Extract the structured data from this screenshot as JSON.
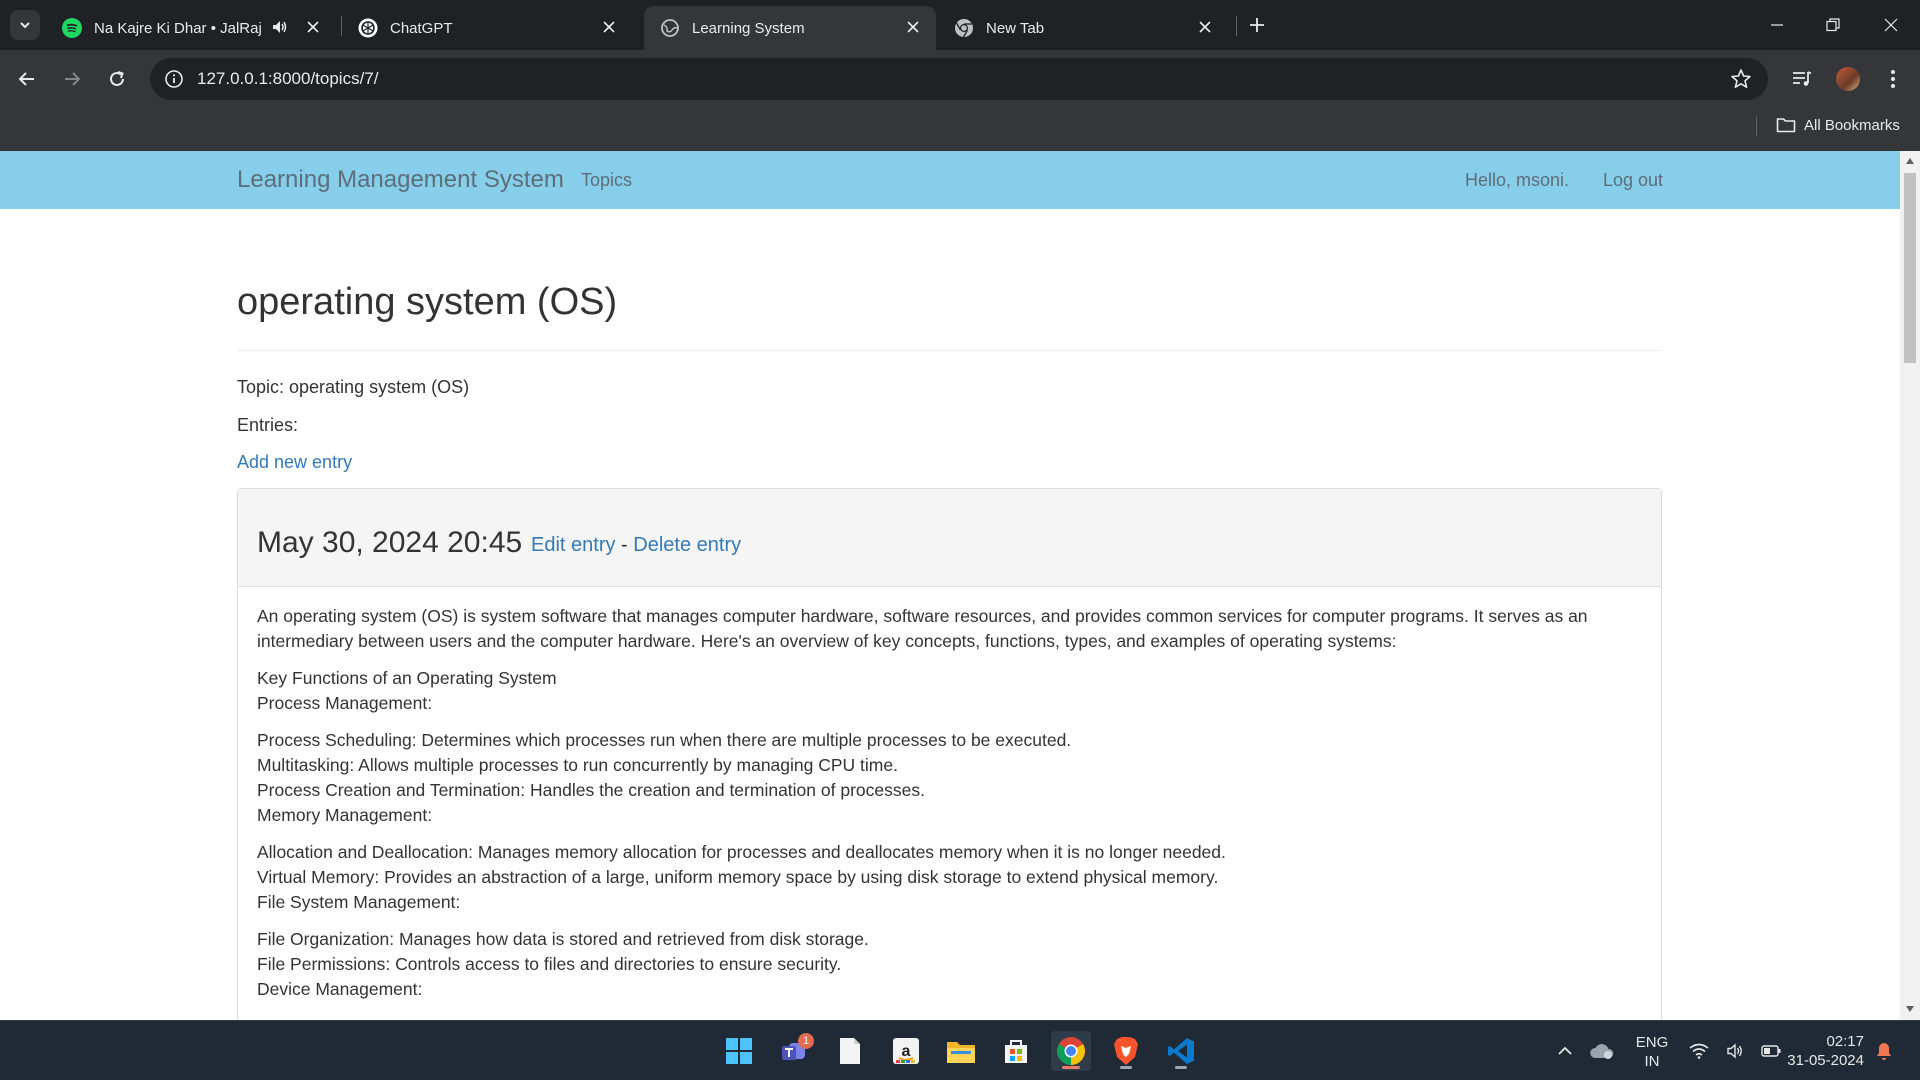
{
  "browser": {
    "tabs": [
      {
        "title": "Na Kajre Ki Dhar • JalRaj",
        "icon": "spotify-icon",
        "audio": true,
        "active": false
      },
      {
        "title": "ChatGPT",
        "icon": "chatgpt-icon",
        "active": false
      },
      {
        "title": "Learning System",
        "icon": "globe-icon",
        "active": true
      },
      {
        "title": "New Tab",
        "icon": "chrome-icon",
        "active": false
      }
    ],
    "url": "127.0.0.1:8000/topics/7/",
    "bookmarks_label": "All Bookmarks",
    "colors": {
      "frame": "#202124",
      "toolbar": "#35363a",
      "omnibox": "#202124",
      "text": "#e8eaed"
    }
  },
  "site": {
    "brand": "Learning Management System",
    "nav_topics": "Topics",
    "greeting": "Hello, msoni.",
    "logout": "Log out",
    "colors": {
      "navbar": "#87ceeb",
      "link": "#337ab7"
    }
  },
  "page": {
    "title": "operating system (OS)",
    "topic_line": "Topic: operating system (OS)",
    "entries_label": "Entries:",
    "add_entry": "Add new entry"
  },
  "entry": {
    "date": "May 30, 2024 20:45",
    "edit": "Edit entry",
    "separator": "-",
    "delete": "Delete entry",
    "paragraphs": [
      [
        "An operating system (OS) is system software that manages computer hardware, software resources, and provides common services for computer programs. It serves as an intermediary between users and the computer hardware. Here's an overview of key concepts, functions, types, and examples of operating systems:"
      ],
      [
        "Key Functions of an Operating System",
        "Process Management:"
      ],
      [
        "Process Scheduling: Determines which processes run when there are multiple processes to be executed.",
        "Multitasking: Allows multiple processes to run concurrently by managing CPU time.",
        "Process Creation and Termination: Handles the creation and termination of processes.",
        "Memory Management:"
      ],
      [
        "Allocation and Deallocation: Manages memory allocation for processes and deallocates memory when it is no longer needed.",
        "Virtual Memory: Provides an abstraction of a large, uniform memory space by using disk storage to extend physical memory.",
        "File System Management:"
      ],
      [
        "File Organization: Manages how data is stored and retrieved from disk storage.",
        "File Permissions: Controls access to files and directories to ensure security.",
        "Device Management:"
      ]
    ]
  },
  "taskbar": {
    "apps": [
      "windows-start-icon",
      "teams-icon",
      "notepad-icon",
      "amazon-icon",
      "file-explorer-icon",
      "microsoft-store-icon",
      "chrome-icon",
      "brave-icon",
      "vscode-icon"
    ],
    "teams_badge": "1",
    "lang_top": "ENG",
    "lang_bottom": "IN",
    "time": "02:17",
    "date": "31-05-2024"
  }
}
